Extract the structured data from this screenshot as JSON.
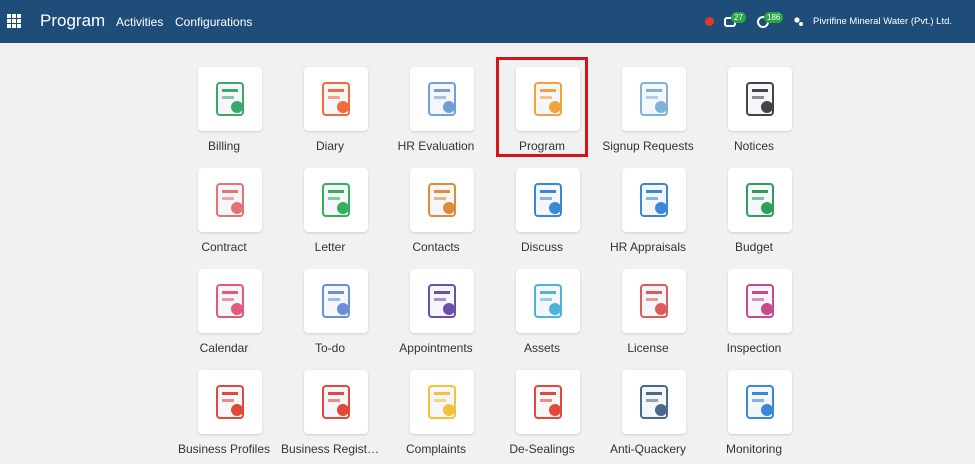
{
  "topbar": {
    "title": "Program",
    "menu": [
      "Activities",
      "Configurations"
    ],
    "chat_count": "27",
    "activity_count": "186",
    "company": "Pivrifine Mineral Water (Pvt.) Ltd."
  },
  "apps": [
    {
      "label": "Billing",
      "icon": "billing-icon",
      "color": "#3aa86b"
    },
    {
      "label": "Diary",
      "icon": "diary-icon",
      "color": "#ef6b3a"
    },
    {
      "label": "HR Evaluation",
      "icon": "hr-evaluation-icon",
      "color": "#6fa0d8"
    },
    {
      "label": "Program",
      "icon": "program-icon",
      "color": "#f2a23a"
    },
    {
      "label": "Signup Requests",
      "icon": "signup-requests-icon",
      "color": "#7fb3d5"
    },
    {
      "label": "Notices",
      "icon": "notices-icon",
      "color": "#444444"
    },
    {
      "label": "Contract",
      "icon": "contract-icon",
      "color": "#e57373"
    },
    {
      "label": "Letter",
      "icon": "letter-icon",
      "color": "#35b05a"
    },
    {
      "label": "Contacts",
      "icon": "contacts-icon",
      "color": "#e08a3c"
    },
    {
      "label": "Discuss",
      "icon": "discuss-icon",
      "color": "#3a87d8"
    },
    {
      "label": "HR Appraisals",
      "icon": "hr-appraisals-icon",
      "color": "#3a87d8"
    },
    {
      "label": "Budget",
      "icon": "budget-icon",
      "color": "#2e9e5a"
    },
    {
      "label": "Calendar",
      "icon": "calendar-icon",
      "color": "#e05a7a"
    },
    {
      "label": "To-do",
      "icon": "todo-icon",
      "color": "#6a8fd8"
    },
    {
      "label": "Appointments",
      "icon": "appointments-icon",
      "color": "#6a4fa8"
    },
    {
      "label": "Assets",
      "icon": "assets-icon",
      "color": "#4fb3d8"
    },
    {
      "label": "License",
      "icon": "license-icon",
      "color": "#e05a5a"
    },
    {
      "label": "Inspection",
      "icon": "inspection-icon",
      "color": "#c94a8a"
    },
    {
      "label": "Business Profiles",
      "icon": "business-profiles-icon",
      "color": "#e0483a"
    },
    {
      "label": "Business Regist…",
      "icon": "business-registration-icon",
      "color": "#e0483a"
    },
    {
      "label": "Complaints",
      "icon": "complaints-icon",
      "color": "#f2c23a"
    },
    {
      "label": "De-Sealings",
      "icon": "de-sealings-icon",
      "color": "#e0483a"
    },
    {
      "label": "Anti-Quackery",
      "icon": "anti-quackery-icon",
      "color": "#4a6a8a"
    },
    {
      "label": "Monitoring",
      "icon": "monitoring-icon",
      "color": "#3a87d8"
    }
  ],
  "selected_app": "Program",
  "colors": {
    "topbar": "#1f4d7a",
    "badge": "#28a745",
    "highlight": "#d4151b"
  }
}
